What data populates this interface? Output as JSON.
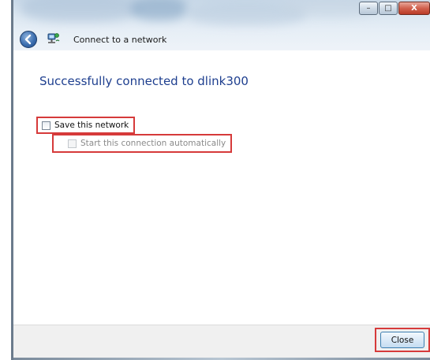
{
  "window": {
    "title": "Connect to a network",
    "controls": {
      "minimize": "–",
      "maximize": "□",
      "close": "X"
    },
    "icons": {
      "back": "back-arrow-icon",
      "network": "network-connection-icon"
    }
  },
  "content": {
    "heading": "Successfully connected to dlink300",
    "save_network_label": "Save this network",
    "save_network_checked": false,
    "auto_start_label": "Start this connection automatically",
    "auto_start_checked": false,
    "auto_start_enabled": false
  },
  "footer": {
    "close_label": "Close"
  },
  "colors": {
    "heading": "#1e3f8f",
    "highlight": "#d63a3a",
    "footer_bg": "#f0f0f0"
  }
}
